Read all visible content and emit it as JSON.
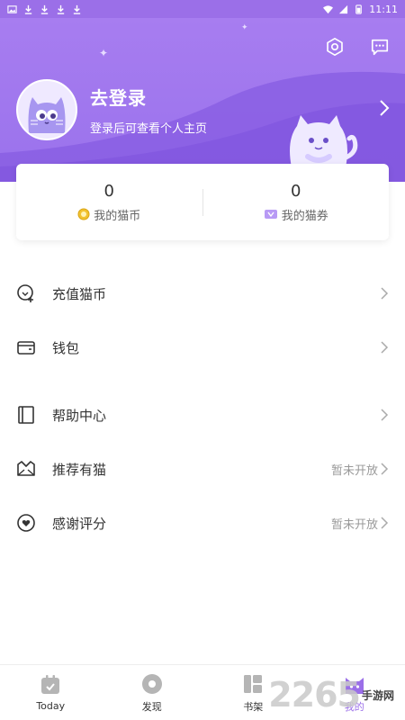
{
  "status_bar": {
    "time": "11:11",
    "icons": [
      "image-icon",
      "download-icon",
      "download-icon",
      "download-icon",
      "download-icon"
    ],
    "right_icons": [
      "wifi-icon",
      "signal-icon",
      "battery-icon"
    ]
  },
  "header": {
    "actions": [
      "settings-icon",
      "message-icon"
    ],
    "login_title": "去登录",
    "login_subtitle": "登录后可查看个人主页"
  },
  "stats": {
    "coins_value": "0",
    "coins_label": "我的猫币",
    "tickets_value": "0",
    "tickets_label": "我的猫券"
  },
  "menu_groups": [
    {
      "items": [
        {
          "label": "充值猫币",
          "icon": "recharge-icon",
          "status": ""
        },
        {
          "label": "钱包",
          "icon": "wallet-icon",
          "status": ""
        }
      ]
    },
    {
      "items": [
        {
          "label": "帮助中心",
          "icon": "help-book-icon",
          "status": ""
        },
        {
          "label": "推荐有猫",
          "icon": "recommend-icon",
          "status": "暂未开放"
        },
        {
          "label": "感谢评分",
          "icon": "rating-icon",
          "status": "暂未开放"
        }
      ]
    }
  ],
  "bottom_nav": {
    "items": [
      {
        "label": "Today",
        "icon": "calendar-icon",
        "active": false
      },
      {
        "label": "发现",
        "icon": "discover-icon",
        "active": false
      },
      {
        "label": "书架",
        "icon": "bookshelf-icon",
        "active": false
      },
      {
        "label": "我的",
        "icon": "cat-profile-icon",
        "active": true
      }
    ]
  },
  "watermark": {
    "number": "2265",
    "text": "手游网"
  },
  "colors": {
    "accent": "#9b6fe8",
    "header_bg": "#a77df0",
    "text_muted": "#999999"
  }
}
